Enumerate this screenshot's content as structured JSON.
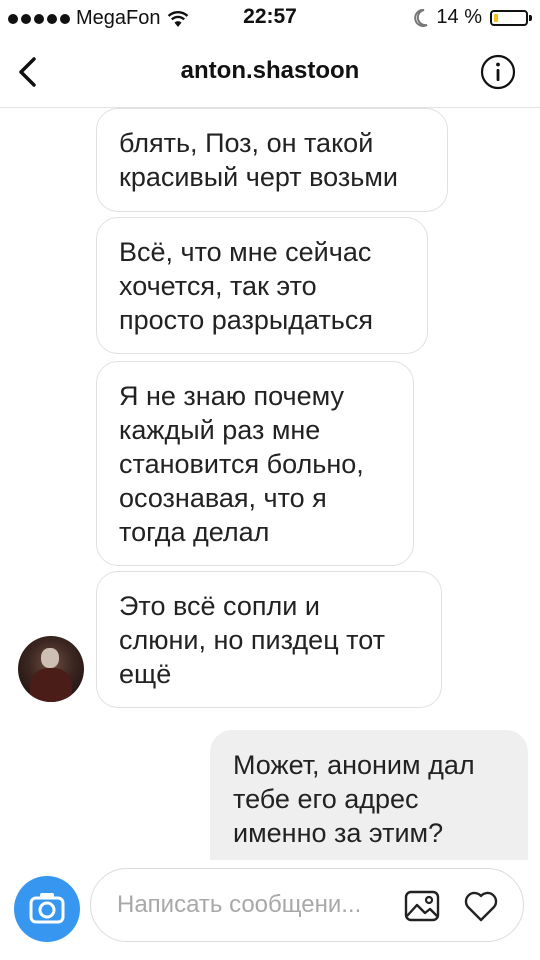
{
  "status_bar": {
    "carrier": "MegaFon",
    "time": "22:57",
    "battery_percent_text": "14 %",
    "battery_level": 0.14,
    "signal_bars": 5,
    "icons": [
      "signal-dots-icon",
      "wifi-icon",
      "moon-icon",
      "battery-icon"
    ]
  },
  "header": {
    "title": "anton.shastoon",
    "back_icon": "chevron-left-icon",
    "info_icon": "info-icon"
  },
  "messages": [
    {
      "direction": "incoming",
      "text": "блять, Поз, он такой\nкрасивый черт возьми"
    },
    {
      "direction": "incoming",
      "text": "Всё, что мне сейчас\nхочется, так это\nпросто разрыдаться"
    },
    {
      "direction": "incoming",
      "text": "Я не знаю почему\nкаждый раз мне\nстановится больно,\nосознавая, что я\nтогда делал"
    },
    {
      "direction": "incoming",
      "text": "Это всё сопли и\nслюни, но пиздец тот\nещё"
    },
    {
      "direction": "outgoing",
      "text": "Может, аноним дал\nтебе его адрес\nименно за этим?"
    }
  ],
  "composer": {
    "placeholder": "Написать сообщени...",
    "camera_icon": "camera-icon",
    "gallery_icon": "image-icon",
    "like_icon": "heart-icon",
    "accent_color": "#3797f0"
  }
}
